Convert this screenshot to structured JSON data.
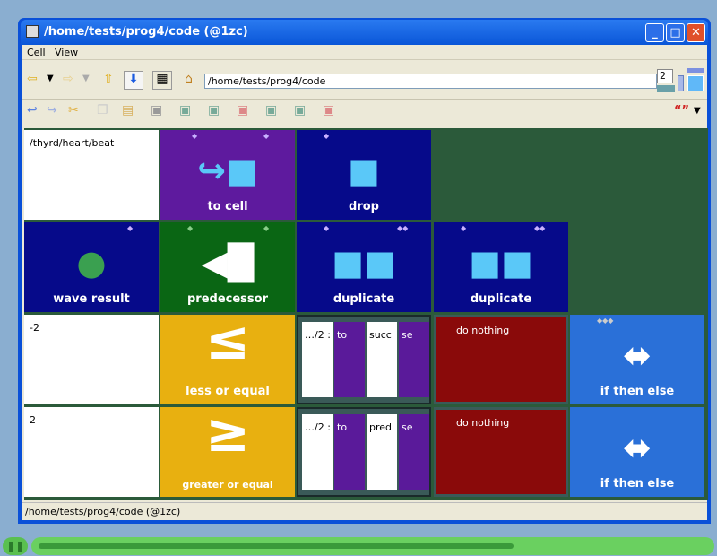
{
  "window": {
    "title": "/home/tests/prog4/code (@1zc)",
    "controls": [
      "minimize",
      "maximize",
      "close"
    ]
  },
  "menu": [
    "Cell",
    "View"
  ],
  "toolbar": {
    "path": "/home/tests/prog4/code",
    "depth": "2",
    "quote_icon": "“”"
  },
  "grid": {
    "r0": {
      "c0": "/thyrd/heart/beat",
      "c1": "to cell",
      "c2": "drop"
    },
    "r1": {
      "c0": "wave result",
      "c1": "predecessor",
      "c2": "duplicate",
      "c3": "duplicate"
    },
    "r2": {
      "c0": "-2",
      "c1": "less or equal",
      "sub_a": "…/2 :",
      "sub_b": "to",
      "sub_c": "succ",
      "sub_d": "se",
      "c3": "do nothing",
      "c4": "if then else"
    },
    "r3": {
      "c0": "2",
      "c1": "greater or equal",
      "sub_a": "…/2 :",
      "sub_b": "to",
      "sub_c": "pred",
      "sub_d": "se",
      "c3": "do nothing",
      "c4": "if then else"
    }
  },
  "status": "/home/tests/prog4/code (@1zc)",
  "playback": {
    "progress": 0.71,
    "state": "playing"
  },
  "colors": {
    "purple": "#5e1a9e",
    "navy": "#060a8a",
    "green": "#0a6614",
    "yellow": "#e8b010",
    "red": "#8a0a0a",
    "blue": "#2a70d8"
  }
}
